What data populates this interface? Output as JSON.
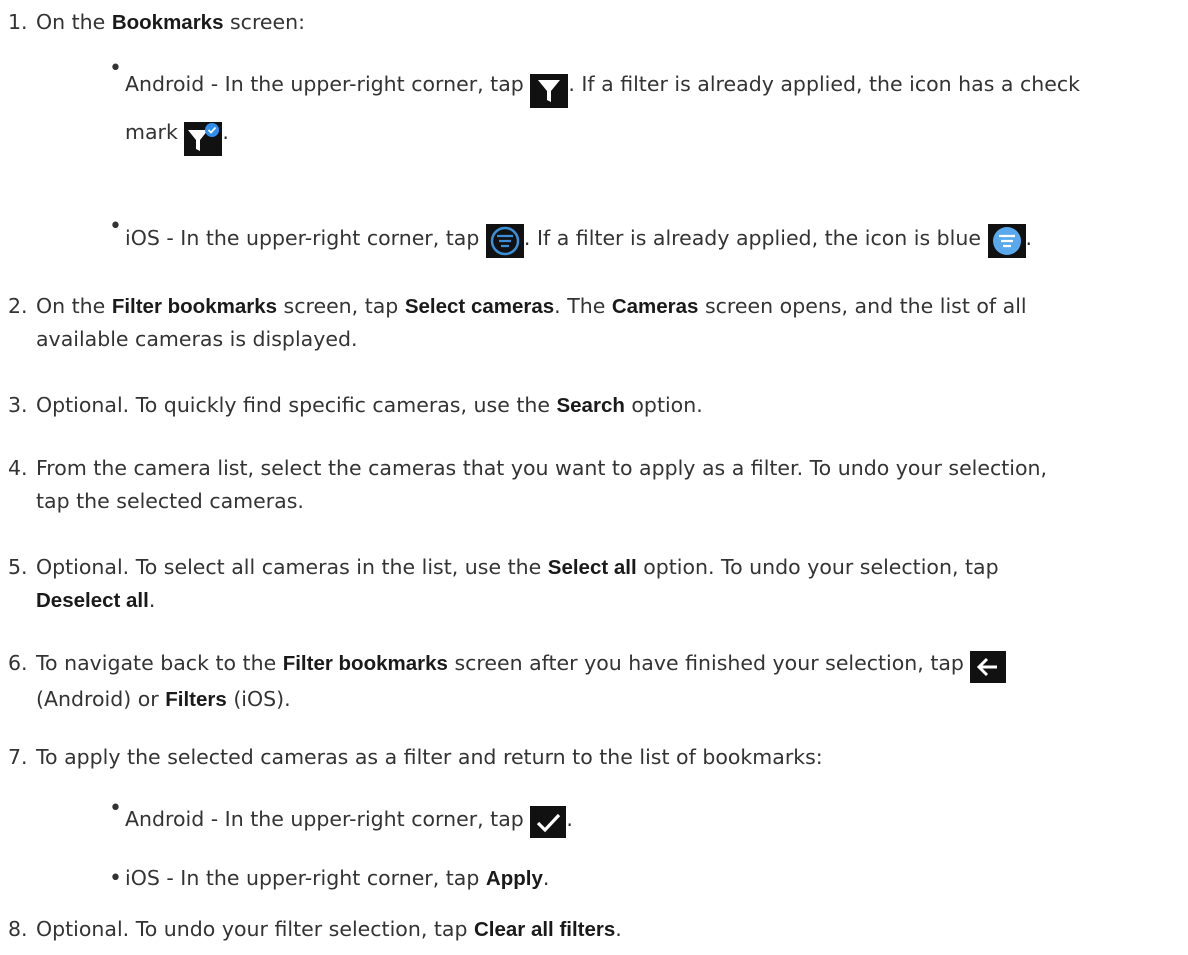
{
  "steps": [
    {
      "num": "1.",
      "pre": "On the ",
      "b1": "Bookmarks",
      "post": " screen:"
    },
    {
      "num": "2.",
      "pre": "On the ",
      "b1": "Filter bookmarks",
      "mid1": " screen, tap ",
      "b2": "Select cameras",
      "mid2": ". The ",
      "b3": "Cameras",
      "post1": " screen opens, and the list of all",
      "post2": "available cameras is displayed."
    },
    {
      "num": "3.",
      "pre": "Optional. To quickly find specific cameras, use the ",
      "b1": "Search",
      "post": " option."
    },
    {
      "num": "4.",
      "line1": "From the camera list, select the cameras that you want to apply as a filter. To undo your selection,",
      "line2": "tap the selected cameras."
    },
    {
      "num": "5.",
      "pre": "Optional. To select all cameras in the list, use the ",
      "b1": "Select all",
      "post": " option. To undo your selection, tap",
      "b2": "Deselect all",
      "end": "."
    },
    {
      "num": "6.",
      "pre": "To navigate back to the ",
      "b1": "Filter bookmarks",
      "post": " screen after you have finished your selection, tap ",
      "l2pre": "(Android) or ",
      "b2": "Filters",
      "l2post": " (iOS)."
    },
    {
      "num": "7.",
      "text": "To apply the selected cameras as a filter and return to the list of bookmarks:"
    },
    {
      "num": "8.",
      "pre": "Optional. To undo your filter selection, tap ",
      "b1": "Clear all filters",
      "end": "."
    }
  ],
  "subs": {
    "a1": {
      "bullet": "•",
      "pre": "Android - In the upper-right corner, tap ",
      "mid": ". If a filter is already applied, the icon has a check",
      "l2": "mark ",
      "end": "."
    },
    "a2": {
      "bullet": "•",
      "pre": "iOS - In the upper-right corner, tap ",
      "mid": ". If a filter is already applied, the icon is blue ",
      "end": "."
    },
    "b1": {
      "bullet": "•",
      "pre": "Android - In the upper-right corner, tap ",
      "end": "."
    },
    "b2": {
      "bullet": "•",
      "pre": "iOS - In the upper-right corner, tap ",
      "b": "Apply",
      "end": "."
    }
  },
  "icons": {
    "android_filter": "filter-funnel-icon",
    "android_filter_checked": "filter-funnel-checked-icon",
    "ios_filter": "filter-lines-icon",
    "ios_filter_applied": "filter-lines-blue-icon",
    "android_back": "back-arrow-icon",
    "android_apply": "checkmark-icon"
  },
  "colors": {
    "icon_bg": "#111111",
    "accent_blue": "#2f8ff0",
    "ios_blue": "#5aa9ec"
  }
}
